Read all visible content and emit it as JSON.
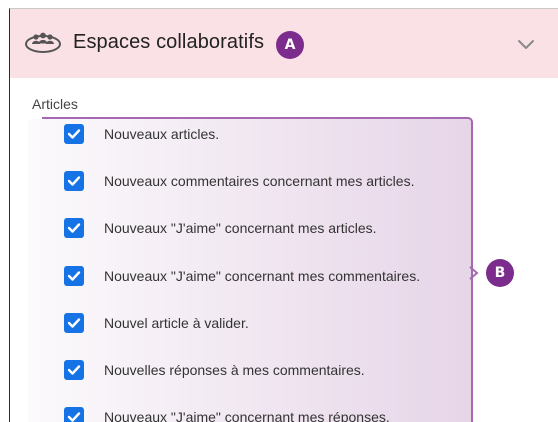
{
  "header": {
    "icon": "group-icon",
    "title": "Espaces collaboratifs",
    "badge_a": "A",
    "toggle_icon": "chevron-down-icon"
  },
  "colors": {
    "header_background": "#fae1e6",
    "badge": "#7b2c8c",
    "checkbox": "#1573e5",
    "highlight_border": "#a668b1"
  },
  "section": {
    "label": "Articles",
    "badge_b": "B",
    "options": [
      {
        "label": "Nouveaux articles.",
        "checked": true
      },
      {
        "label": "Nouveaux commentaires concernant mes articles.",
        "checked": true
      },
      {
        "label": "Nouveaux \"J'aime\" concernant mes articles.",
        "checked": true
      },
      {
        "label": "Nouveaux \"J'aime\" concernant mes commentaires.",
        "checked": true
      },
      {
        "label": "Nouvel article à valider.",
        "checked": true
      },
      {
        "label": "Nouvelles réponses à mes commentaires.",
        "checked": true
      },
      {
        "label": "Nouveaux \"J'aime\" concernant mes réponses.",
        "checked": true
      }
    ]
  }
}
